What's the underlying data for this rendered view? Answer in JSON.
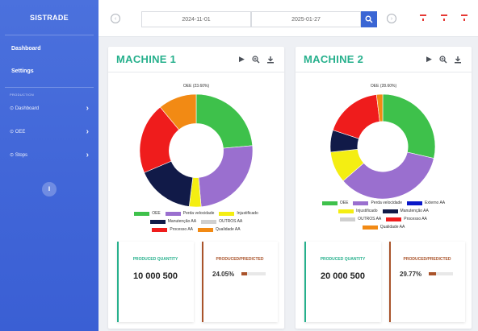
{
  "sidebar": {
    "brand": "SISTRADE",
    "nav": [
      "Dashboard",
      "Settings"
    ],
    "section_label": "PRODUCTION",
    "sub_items": [
      "Dashboard",
      "OEE",
      "Stops"
    ]
  },
  "topbar": {
    "date_from": "2024-11-01",
    "date_to": "2025-01-27"
  },
  "colors": {
    "green": "#3ec14b",
    "purple": "#9a6fcf",
    "yellow": "#f4ee12",
    "navy": "#111a48",
    "grey": "#cfcfcf",
    "red": "#ef1c1c",
    "orange": "#f28a14",
    "blue": "#0a18c8",
    "teal": "#26b08c",
    "brown": "#a9532a"
  },
  "machines": [
    {
      "title": "MACHINE 1",
      "chart_title": "OEE (23.60%)",
      "kpi_quantity_label": "PRODUCED QUANTITY",
      "kpi_quantity_value": "10 000 500",
      "kpi_ratio_label": "PRODUCED/PREDICTED",
      "kpi_ratio_value": "24.05%",
      "kpi_ratio_fraction": 0.24,
      "legend_rows": [
        [
          {
            "label": "OEE",
            "color": "green"
          },
          {
            "label": "Perda velocidade",
            "color": "purple"
          },
          {
            "label": "Injustificado",
            "color": "yellow"
          }
        ],
        [
          {
            "label": "Manutenção AA",
            "color": "navy"
          },
          {
            "label": "OUTROS AA",
            "color": "grey"
          }
        ],
        [
          {
            "label": "Processo AA",
            "color": "red"
          },
          {
            "label": "Qualidade AA",
            "color": "orange"
          }
        ]
      ]
    },
    {
      "title": "MACHINE 2",
      "chart_title": "OEE (28.60%)",
      "kpi_quantity_label": "PRODUCED QUANTITY",
      "kpi_quantity_value": "20 000 500",
      "kpi_ratio_label": "PRODUCED/PREDICTED",
      "kpi_ratio_value": "29.77%",
      "kpi_ratio_fraction": 0.3,
      "legend_rows": [
        [
          {
            "label": "OEE",
            "color": "green"
          },
          {
            "label": "Perda velocidade",
            "color": "purple"
          },
          {
            "label": "Externo AA",
            "color": "blue"
          }
        ],
        [
          {
            "label": "Injustificado",
            "color": "yellow"
          },
          {
            "label": "Manutenção AA",
            "color": "navy"
          }
        ],
        [
          {
            "label": "OUTROS AA",
            "color": "grey"
          },
          {
            "label": "Processo AA",
            "color": "red"
          }
        ],
        [
          {
            "label": "Qualidade AA",
            "color": "orange"
          }
        ]
      ]
    }
  ],
  "chart_data": [
    {
      "type": "pie",
      "title": "OEE (23.60%)",
      "categories": [
        "OEE",
        "Perda velocidade",
        "Injustificado",
        "Manutenção AA",
        "Processo AA",
        "Qualidade AA"
      ],
      "values": [
        23.6,
        25.0,
        3.4,
        16.6,
        20.4,
        11.0
      ],
      "colors": [
        "green",
        "purple",
        "yellow",
        "navy",
        "red",
        "orange"
      ]
    },
    {
      "type": "pie",
      "title": "OEE (28.60%)",
      "categories": [
        "OEE",
        "Perda velocidade",
        "Injustificado",
        "Manutenção AA",
        "Processo AA",
        "Qualidade AA"
      ],
      "values": [
        28.6,
        35.0,
        9.7,
        6.8,
        18.0,
        1.9
      ],
      "colors": [
        "green",
        "purple",
        "yellow",
        "navy",
        "red",
        "orange"
      ]
    }
  ]
}
